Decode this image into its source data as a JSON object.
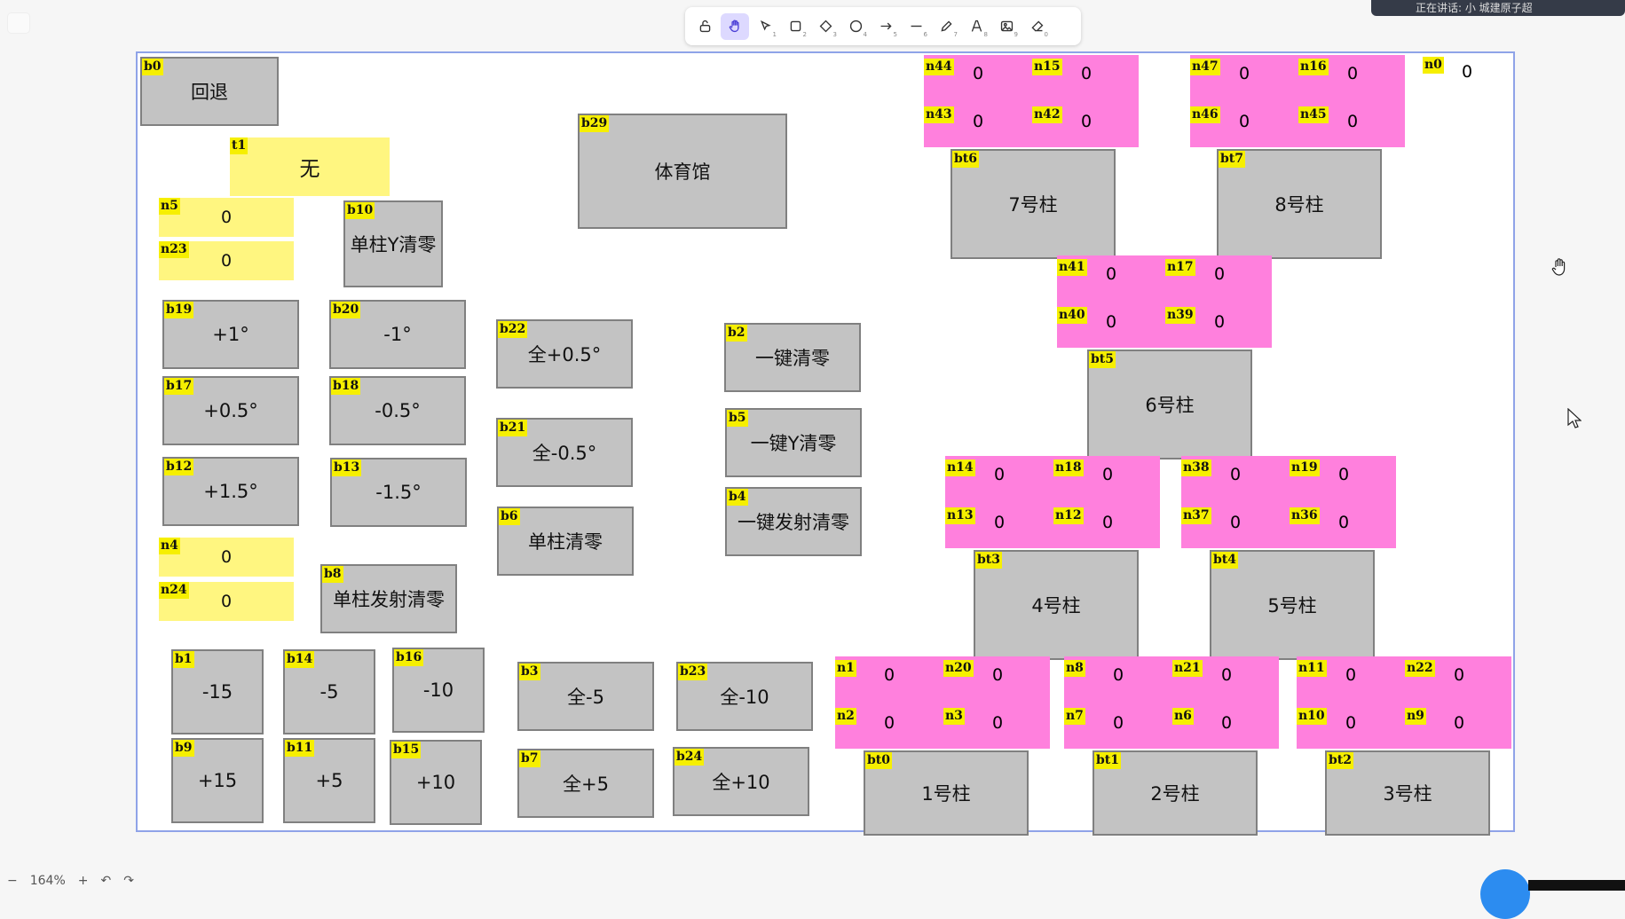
{
  "toolbar": {
    "tools": [
      {
        "name": "lock-icon",
        "key": ""
      },
      {
        "name": "hand-icon",
        "key": ""
      },
      {
        "name": "select-icon",
        "key": "1"
      },
      {
        "name": "rectangle-icon",
        "key": "2"
      },
      {
        "name": "diamond-icon",
        "key": "3"
      },
      {
        "name": "ellipse-icon",
        "key": "4"
      },
      {
        "name": "arrow-icon",
        "key": "5"
      },
      {
        "name": "line-icon",
        "key": "6"
      },
      {
        "name": "pencil-icon",
        "key": "7"
      },
      {
        "name": "text-icon",
        "key": "8"
      },
      {
        "name": "image-icon",
        "key": "9"
      },
      {
        "name": "eraser-icon",
        "key": "0"
      }
    ]
  },
  "notification": {
    "text": "正在讲话: 小  城建原子超"
  },
  "zoom": {
    "minus": "−",
    "value": "164%",
    "plus": "+",
    "undo": "↶",
    "redo": "↷"
  },
  "colors": {
    "button": "#c3c3c3",
    "yellow": "#fff680",
    "pink": "#ff80dd",
    "tag": "#f6ef00",
    "frame": "#8fa3e8"
  },
  "canvas": {
    "buttons": [
      {
        "id": "b0",
        "label": "回退"
      },
      {
        "id": "b29",
        "label": "体育馆"
      },
      {
        "id": "b10",
        "label": "单柱Y清零"
      },
      {
        "id": "b19",
        "label": "+1°"
      },
      {
        "id": "b20",
        "label": "-1°"
      },
      {
        "id": "b17",
        "label": "+0.5°"
      },
      {
        "id": "b18",
        "label": "-0.5°"
      },
      {
        "id": "b12",
        "label": "+1.5°"
      },
      {
        "id": "b13",
        "label": "-1.5°"
      },
      {
        "id": "b22",
        "label": "全+0.5°"
      },
      {
        "id": "b21",
        "label": "全-0.5°"
      },
      {
        "id": "b6",
        "label": "单柱清零"
      },
      {
        "id": "b2",
        "label": "一键清零"
      },
      {
        "id": "b5",
        "label": "一键Y清零"
      },
      {
        "id": "b4",
        "label": "一键发射清零"
      },
      {
        "id": "b8",
        "label": "单柱发射清零"
      },
      {
        "id": "b1",
        "label": "-15"
      },
      {
        "id": "b14",
        "label": "-5"
      },
      {
        "id": "b16",
        "label": "-10"
      },
      {
        "id": "b9",
        "label": "+15"
      },
      {
        "id": "b11",
        "label": "+5"
      },
      {
        "id": "b15",
        "label": "+10"
      },
      {
        "id": "b3",
        "label": "全-5"
      },
      {
        "id": "b23",
        "label": "全-10"
      },
      {
        "id": "b7",
        "label": "全+5"
      },
      {
        "id": "b24",
        "label": "全+10"
      },
      {
        "id": "bt6",
        "label": "7号柱"
      },
      {
        "id": "bt7",
        "label": "8号柱"
      },
      {
        "id": "bt5",
        "label": "6号柱"
      },
      {
        "id": "bt3",
        "label": "4号柱"
      },
      {
        "id": "bt4",
        "label": "5号柱"
      },
      {
        "id": "bt0",
        "label": "1号柱"
      },
      {
        "id": "bt1",
        "label": "2号柱"
      },
      {
        "id": "bt2",
        "label": "3号柱"
      }
    ],
    "yellow_fields": [
      {
        "id": "t1",
        "value": "无"
      },
      {
        "id": "n5",
        "value": "0"
      },
      {
        "id": "n23",
        "value": "0"
      },
      {
        "id": "n4",
        "value": "0"
      },
      {
        "id": "n24",
        "value": "0"
      }
    ],
    "pink_groups": [
      {
        "cells": [
          {
            "id": "n44",
            "value": "0"
          },
          {
            "id": "n15",
            "value": "0"
          },
          {
            "id": "n43",
            "value": "0"
          },
          {
            "id": "n42",
            "value": "0"
          }
        ]
      },
      {
        "cells": [
          {
            "id": "n47",
            "value": "0"
          },
          {
            "id": "n16",
            "value": "0"
          },
          {
            "id": "n46",
            "value": "0"
          },
          {
            "id": "n45",
            "value": "0"
          }
        ]
      },
      {
        "cells": [
          {
            "id": "n41",
            "value": "0"
          },
          {
            "id": "n17",
            "value": "0"
          },
          {
            "id": "n40",
            "value": "0"
          },
          {
            "id": "n39",
            "value": "0"
          }
        ]
      },
      {
        "cells": [
          {
            "id": "n14",
            "value": "0"
          },
          {
            "id": "n18",
            "value": "0"
          },
          {
            "id": "n13",
            "value": "0"
          },
          {
            "id": "n12",
            "value": "0"
          }
        ]
      },
      {
        "cells": [
          {
            "id": "n38",
            "value": "0"
          },
          {
            "id": "n19",
            "value": "0"
          },
          {
            "id": "n37",
            "value": "0"
          },
          {
            "id": "n36",
            "value": "0"
          }
        ]
      },
      {
        "cells": [
          {
            "id": "n1",
            "value": "0"
          },
          {
            "id": "n20",
            "value": "0"
          },
          {
            "id": "n2",
            "value": "0"
          },
          {
            "id": "n3",
            "value": "0"
          }
        ]
      },
      {
        "cells": [
          {
            "id": "n8",
            "value": "0"
          },
          {
            "id": "n21",
            "value": "0"
          },
          {
            "id": "n7",
            "value": "0"
          },
          {
            "id": "n6",
            "value": "0"
          }
        ]
      },
      {
        "cells": [
          {
            "id": "n11",
            "value": "0"
          },
          {
            "id": "n22",
            "value": "0"
          },
          {
            "id": "n10",
            "value": "0"
          },
          {
            "id": "n9",
            "value": "0"
          }
        ]
      }
    ],
    "n0": {
      "id": "n0",
      "value": "0"
    }
  }
}
